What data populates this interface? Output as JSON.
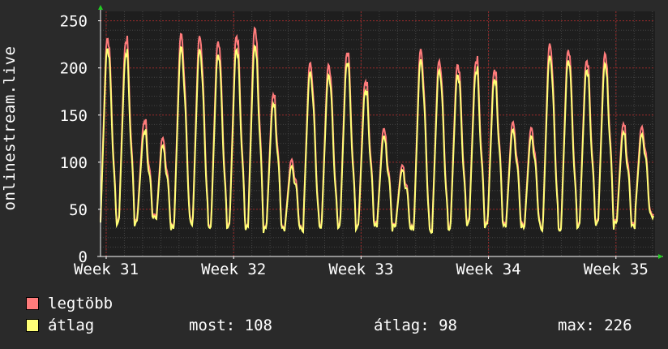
{
  "chart_data": {
    "type": "line",
    "title": "",
    "ylabel": "onlinestream.live",
    "xlabel": "",
    "x_ticks": [
      "Week 31",
      "Week 32",
      "Week 33",
      "Week 34",
      "Week 35"
    ],
    "y_ticks": [
      "0",
      "50",
      "100",
      "150",
      "200",
      "250"
    ],
    "ylim": [
      0,
      260
    ],
    "grid": true,
    "days": 35,
    "series": [
      {
        "name": "legtöbb",
        "color": "#ff7b7b",
        "daily_peak": [
          232,
          228,
          143,
          126,
          237,
          234,
          228,
          234,
          243,
          172,
          103,
          206,
          204,
          216,
          186,
          136,
          97,
          220,
          208,
          204,
          207,
          198,
          143,
          137,
          226,
          219,
          208,
          216,
          141,
          138
        ],
        "daily_min": [
          38,
          37,
          42,
          31,
          38,
          35,
          35,
          31,
          29,
          29,
          30,
          35,
          35,
          32,
          34,
          32,
          31,
          29,
          33,
          37,
          34,
          33,
          33,
          31,
          31,
          35,
          36,
          36,
          33,
          45
        ]
      },
      {
        "name": "átlag",
        "color": "#ffff77",
        "daily_peak": [
          221,
          214,
          132,
          118,
          223,
          220,
          214,
          220,
          224,
          162,
          96,
          196,
          193,
          205,
          176,
          128,
          92,
          209,
          198,
          193,
          196,
          188,
          135,
          128,
          213,
          208,
          198,
          205,
          132,
          130
        ],
        "daily_min": [
          36,
          35,
          40,
          30,
          36,
          33,
          33,
          30,
          28,
          28,
          29,
          33,
          33,
          31,
          32,
          31,
          30,
          28,
          31,
          35,
          32,
          31,
          31,
          30,
          30,
          33,
          34,
          34,
          31,
          43
        ]
      }
    ]
  },
  "legend": {
    "items": [
      {
        "label": "legtöbb",
        "color": "#ff7b7b"
      },
      {
        "label": "átlag",
        "color": "#ffff77"
      }
    ],
    "stats": {
      "current": "most: 108",
      "average": "átlag: 98",
      "max": "max: 226"
    }
  },
  "colors": {
    "background": "#2a2a2a",
    "plot_background": "#1e1e1e",
    "grid_minor": "#444444",
    "grid_major": "#9a2a2a",
    "axis": "#ffffff",
    "arrow": "#22cc22"
  }
}
